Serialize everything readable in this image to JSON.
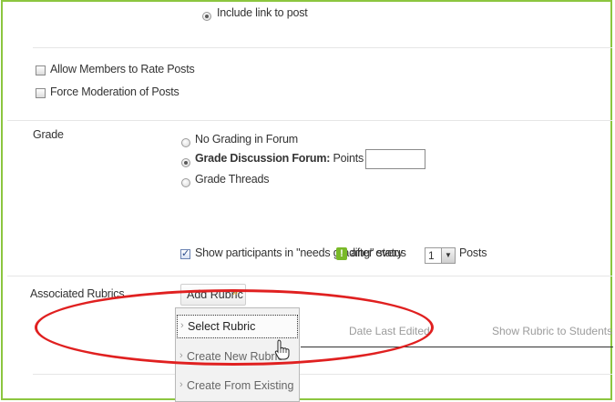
{
  "notifications": {
    "include_link_label": "Include link to post"
  },
  "options": {
    "allow_rate_label": "Allow Members to Rate Posts",
    "force_moderation_label": "Force Moderation of Posts"
  },
  "grade": {
    "label": "Grade",
    "no_grading_label": "No Grading in Forum",
    "grade_forum_bold": "Grade Discussion Forum:",
    "points_possible_label": "Points possible:",
    "points_value": "",
    "grade_threads_label": "Grade Threads",
    "show_participants_label": "Show participants in \"needs grading\" status",
    "needs_grading_badge": "!",
    "after_every_label": "after every",
    "post_count": "1",
    "posts_label": "Posts"
  },
  "rubrics": {
    "label": "Associated Rubrics",
    "add_rubric_label": "Add Rubric",
    "add_rubric_chevron": "»",
    "menu": [
      {
        "label": "Select Rubric",
        "selected": true
      },
      {
        "label": "Create New Rubric",
        "selected": false
      },
      {
        "label": "Create From Existing",
        "selected": false
      }
    ],
    "columns": {
      "date_last_edited": "Date Last Edited",
      "show_rubric": "Show Rubric to Students"
    }
  },
  "colors": {
    "frame_border": "#8cc63f",
    "highlight_ellipse": "#e02020",
    "badge_green": "#79b928"
  },
  "icons": {
    "cursor": "hand-pointer-icon",
    "menu_arrow": "chevron-right-icon"
  }
}
